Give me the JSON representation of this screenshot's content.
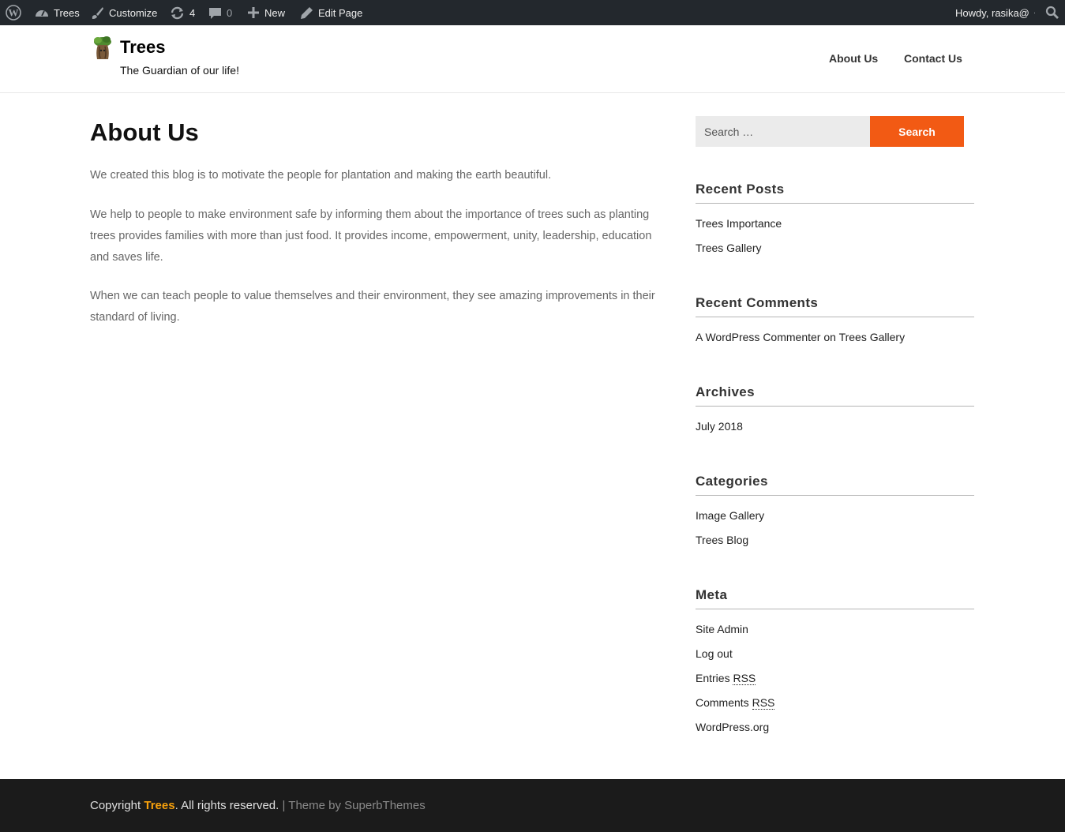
{
  "adminbar": {
    "site_name": "Trees",
    "customize": "Customize",
    "updates_count": "4",
    "comments_count": "0",
    "new": "New",
    "edit_page": "Edit Page",
    "howdy": "Howdy, rasika@"
  },
  "header": {
    "site_title": "Trees",
    "tagline": "The Guardian of our life!",
    "nav": [
      "About Us",
      "Contact Us"
    ]
  },
  "main": {
    "title": "About Us",
    "paragraphs": [
      "We created this blog is to motivate the people for plantation and making the earth beautiful.",
      "We help to people to make environment safe by informing them about the importance of trees such as planting trees provides families with more than just food. It provides income, empowerment, unity, leadership, education and saves life.",
      "When we can teach people to value themselves  and their environment, they see amazing improvements in their standard of living."
    ]
  },
  "sidebar": {
    "search_placeholder": "Search …",
    "search_button": "Search",
    "recent_posts": {
      "title": "Recent Posts",
      "items": [
        "Trees Importance",
        "Trees Gallery"
      ]
    },
    "recent_comments": {
      "title": "Recent Comments",
      "author": "A WordPress Commenter",
      "on": "on",
      "post": "Trees Gallery"
    },
    "archives": {
      "title": "Archives",
      "items": [
        "July 2018"
      ]
    },
    "categories": {
      "title": "Categories",
      "items": [
        "Image Gallery",
        "Trees Blog"
      ]
    },
    "meta": {
      "title": "Meta",
      "site_admin": "Site Admin",
      "log_out": "Log out",
      "entries": "Entries",
      "comments": "Comments",
      "rss": "RSS",
      "wordpress_org": "WordPress.org"
    }
  },
  "footer": {
    "copyright": "Copyright",
    "site_link": "Trees",
    "rights": ". All rights reserved.",
    "separator": "|",
    "theme_by": "Theme by",
    "theme_author": "SuperbThemes"
  },
  "colors": {
    "accent": "#f25a14",
    "footer_link": "#f6a00c",
    "adminbar_bg": "#23282d",
    "footer_bg": "#1b1b1b"
  }
}
